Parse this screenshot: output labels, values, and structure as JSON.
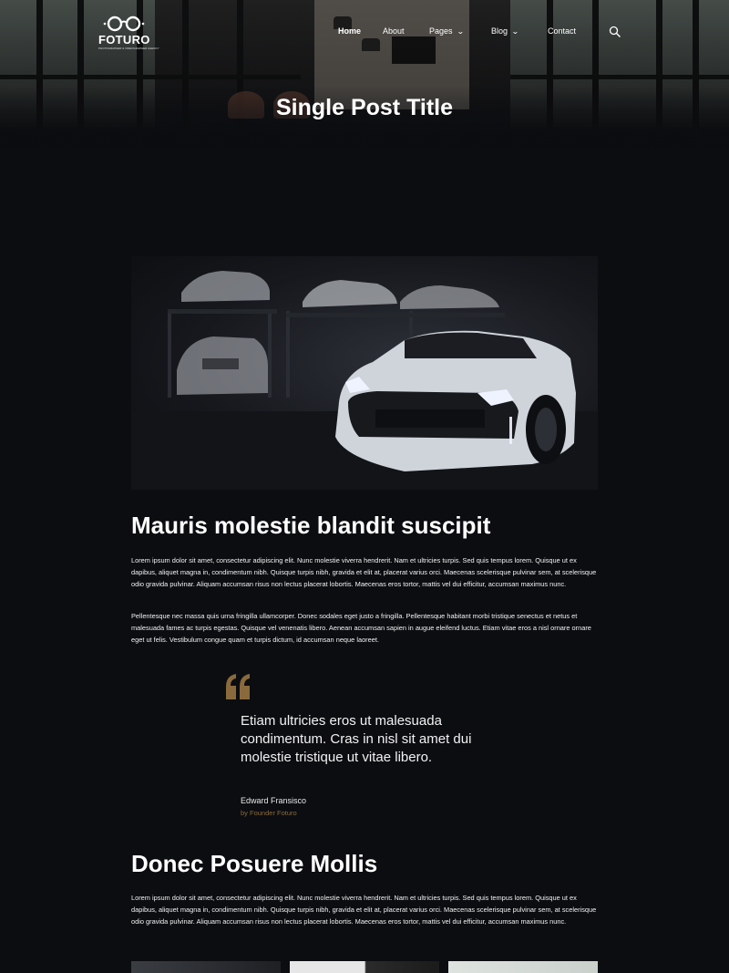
{
  "brand": {
    "name": "FOTURO",
    "tagline": "PHOTOGRAPHER & VIDEOGRAPHER AGENCY"
  },
  "nav": {
    "items": [
      {
        "label": "Home",
        "active": true
      },
      {
        "label": "About"
      },
      {
        "label": "Pages",
        "dropdown": true
      },
      {
        "label": "Blog",
        "dropdown": true
      },
      {
        "label": "Contact"
      }
    ],
    "search_icon": "search-icon"
  },
  "hero": {
    "title": "Single Post Title"
  },
  "article": {
    "heading1": "Mauris molestie blandit suscipit",
    "para1": "Lorem ipsum dolor sit amet, consectetur adipiscing elit. Nunc molestie viverra hendrerit. Nam et ultricies turpis. Sed quis tempus lorem. Quisque ut ex dapibus, aliquet magna in, condimentum nibh. Quisque turpis nibh, gravida et elit at, placerat varius orci. Maecenas scelerisque pulvinar sem, at scelerisque odio gravida pulvinar. Aliquam accumsan risus non lectus placerat lobortis. Maecenas eros tortor, mattis vel dui efficitur, accumsan maximus nunc.",
    "para2": "Pellentesque nec massa quis urna fringilla ullamcorper. Donec sodales eget justo a fringilla. Pellentesque habitant morbi tristique senectus et netus et malesuada fames ac turpis egestas. Quisque vel venenatis libero. Aenean accumsan sapien in augue eleifend luctus. Etiam vitae eros a nisl ornare ornare eget ut felis. Vestibulum congue quam et turpis dictum, id accumsan neque laoreet.",
    "quote": {
      "text": "Etiam ultricies eros ut malesuada condimentum. Cras in nisl sit amet dui molestie tristique ut vitae libero.",
      "author": "Edward Fransisco",
      "role": "by Founder Foturo"
    },
    "heading2": "Donec Posuere Mollis",
    "para3": "Lorem ipsum dolor sit amet, consectetur adipiscing elit. Nunc molestie viverra hendrerit. Nam et ultricies turpis. Sed quis tempus lorem. Quisque ut ex dapibus, aliquet magna in, condimentum nibh. Quisque turpis nibh, gravida et elit at, placerat varius orci. Maecenas scelerisque pulvinar sem, at scelerisque odio gravida pulvinar. Aliquam accumsan risus non lectus placerat lobortis. Maecenas eros tortor, mattis vel dui efficitur, accumsan maximus nunc."
  },
  "colors": {
    "background": "#0b0d11",
    "accent": "#8a6a3c",
    "text": "#ffffff"
  }
}
